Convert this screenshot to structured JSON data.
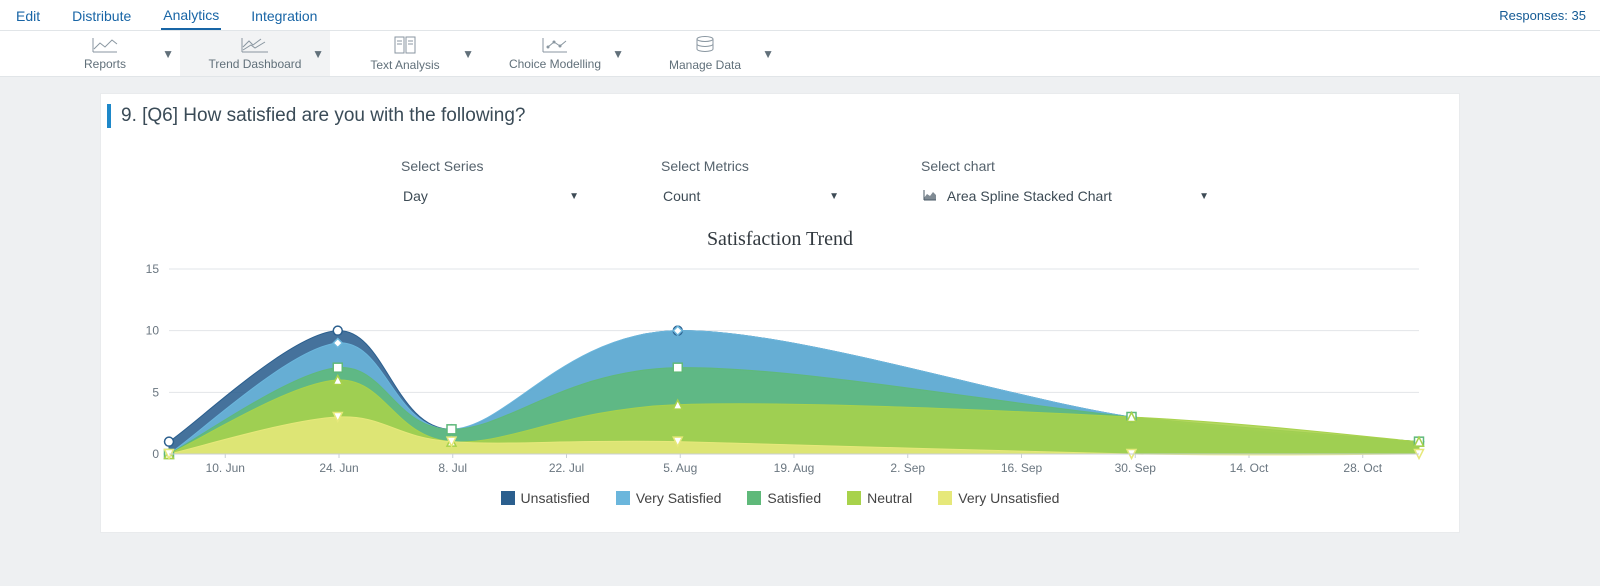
{
  "nav": {
    "items": [
      "Edit",
      "Distribute",
      "Analytics",
      "Integration"
    ],
    "active": "Analytics",
    "responses_label": "Responses: 35"
  },
  "toolbar": {
    "items": [
      {
        "label": "Reports"
      },
      {
        "label": "Trend Dashboard"
      },
      {
        "label": "Text Analysis"
      },
      {
        "label": "Choice Modelling"
      },
      {
        "label": "Manage Data"
      }
    ],
    "active": "Trend Dashboard"
  },
  "question": {
    "title": "9. [Q6] How satisfied are you with the following?"
  },
  "controls": {
    "series_label": "Select Series",
    "series_value": "Day",
    "metrics_label": "Select Metrics",
    "metrics_value": "Count",
    "chart_label": "Select chart",
    "chart_value": "Area Spline Stacked Chart"
  },
  "chart_title": "Satisfaction Trend",
  "legend": {
    "unsatisfied": "Unsatisfied",
    "very_satisfied": "Very Satisfied",
    "satisfied": "Satisfied",
    "neutral": "Neutral",
    "very_unsatisfied": "Very Unsatisfied"
  },
  "colors": {
    "unsatisfied": "#2b5f8e",
    "very_satisfied": "#6bb6dc",
    "satisfied": "#5fb97a",
    "neutral": "#a8d24b",
    "very_unsatisfied": "#e6e87a"
  },
  "chart_data": {
    "type": "area",
    "title": "Satisfaction Trend",
    "xlabel": "",
    "ylabel": "",
    "ylim": [
      0,
      15
    ],
    "yticks": [
      0,
      5,
      10,
      15
    ],
    "x_tick_labels": [
      "10. Jun",
      "24. Jun",
      "8. Jul",
      "22. Jul",
      "5. Aug",
      "19. Aug",
      "2. Sep",
      "16. Sep",
      "30. Sep",
      "14. Oct",
      "28. Oct"
    ],
    "data_point_dates": [
      "3. Jun",
      "24. Jun",
      "8. Jul",
      "5. Aug",
      "30. Sep",
      "6. Nov"
    ],
    "series": [
      {
        "name": "Very Unsatisfied",
        "color": "#e6e87a",
        "values": [
          0,
          3,
          1,
          1,
          0,
          0
        ]
      },
      {
        "name": "Neutral",
        "color": "#a8d24b",
        "values": [
          0,
          3,
          0,
          3,
          3,
          1
        ]
      },
      {
        "name": "Satisfied",
        "color": "#5fb97a",
        "values": [
          0,
          1,
          1,
          3,
          0,
          0
        ]
      },
      {
        "name": "Very Satisfied",
        "color": "#6bb6dc",
        "values": [
          0,
          2,
          0,
          3,
          0,
          0
        ]
      },
      {
        "name": "Unsatisfied",
        "color": "#2b5f8e",
        "values": [
          1,
          1,
          0,
          0,
          0,
          0
        ]
      }
    ],
    "stacked_cumulative": [
      {
        "name": "Very Unsatisfied",
        "cum": [
          0,
          3,
          1,
          1,
          0,
          0
        ]
      },
      {
        "name": "Neutral",
        "cum": [
          0,
          6,
          1,
          4,
          3,
          1
        ]
      },
      {
        "name": "Satisfied",
        "cum": [
          0,
          7,
          2,
          7,
          3,
          1
        ]
      },
      {
        "name": "Very Satisfied",
        "cum": [
          0,
          9,
          2,
          10,
          3,
          1
        ]
      },
      {
        "name": "Unsatisfied",
        "cum": [
          1,
          10,
          2,
          10,
          3,
          1
        ]
      }
    ],
    "legend_order": [
      "Unsatisfied",
      "Very Satisfied",
      "Satisfied",
      "Neutral",
      "Very Unsatisfied"
    ]
  }
}
